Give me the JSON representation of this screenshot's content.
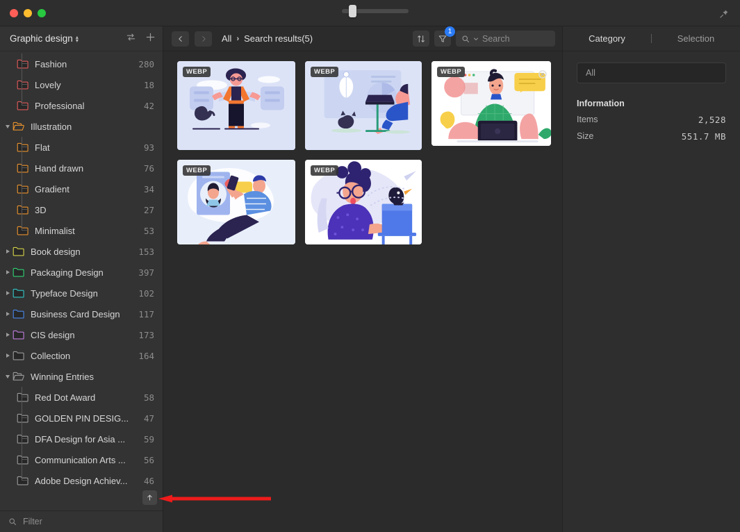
{
  "window": {
    "traffic_lights": [
      "close",
      "minimize",
      "maximize"
    ],
    "zoom_slider_value": 12,
    "pin_icon": "pin-icon"
  },
  "sidebar": {
    "library_title": "Graphic design",
    "header_icons": [
      "sort-transfer-icon",
      "plus-icon"
    ],
    "scroll_top_label": "↑",
    "filter_placeholder": "Filter",
    "items": [
      {
        "label": "Fashion",
        "count": "280",
        "level": 1,
        "color": "#e05a5a",
        "expandable": false,
        "open": false
      },
      {
        "label": "Lovely",
        "count": "18",
        "level": 1,
        "color": "#e05a5a",
        "expandable": false,
        "open": false
      },
      {
        "label": "Professional",
        "count": "42",
        "level": 1,
        "color": "#e05a5a",
        "expandable": false,
        "open": false
      },
      {
        "label": "Illustration",
        "count": "",
        "level": 0,
        "color": "#e8922e",
        "expandable": true,
        "open": true
      },
      {
        "label": "Flat",
        "count": "93",
        "level": 1,
        "color": "#e8922e",
        "expandable": false,
        "open": false
      },
      {
        "label": "Hand drawn",
        "count": "76",
        "level": 1,
        "color": "#e8922e",
        "expandable": false,
        "open": false
      },
      {
        "label": "Gradient",
        "count": "34",
        "level": 1,
        "color": "#e8922e",
        "expandable": false,
        "open": false
      },
      {
        "label": "3D",
        "count": "27",
        "level": 1,
        "color": "#e8922e",
        "expandable": false,
        "open": false
      },
      {
        "label": "Minimalist",
        "count": "53",
        "level": 1,
        "color": "#e8922e",
        "expandable": false,
        "open": false
      },
      {
        "label": "Book design",
        "count": "153",
        "level": 0,
        "color": "#d6d24a",
        "expandable": true,
        "open": false
      },
      {
        "label": "Packaging Design",
        "count": "397",
        "level": 0,
        "color": "#2fcf72",
        "expandable": true,
        "open": false
      },
      {
        "label": "Typeface Design",
        "count": "102",
        "level": 0,
        "color": "#31c5c5",
        "expandable": true,
        "open": false
      },
      {
        "label": "Business Card Design",
        "count": "117",
        "level": 0,
        "color": "#4a86e8",
        "expandable": true,
        "open": false
      },
      {
        "label": "CIS design",
        "count": "173",
        "level": 0,
        "color": "#c07ede",
        "expandable": true,
        "open": false
      },
      {
        "label": "Collection",
        "count": "164",
        "level": 0,
        "color": "#9a9a9a",
        "expandable": true,
        "open": false
      },
      {
        "label": "Winning Entries",
        "count": "",
        "level": 0,
        "color": "#9a9a9a",
        "expandable": true,
        "open": true
      },
      {
        "label": "Red Dot Award",
        "count": "58",
        "level": 1,
        "color": "#9a9a9a",
        "expandable": false,
        "open": false
      },
      {
        "label": "GOLDEN PIN DESIG...",
        "count": "47",
        "level": 1,
        "color": "#9a9a9a",
        "expandable": false,
        "open": false
      },
      {
        "label": "DFA Design for Asia ...",
        "count": "59",
        "level": 1,
        "color": "#9a9a9a",
        "expandable": false,
        "open": false
      },
      {
        "label": "Communication Arts ...",
        "count": "56",
        "level": 1,
        "color": "#9a9a9a",
        "expandable": false,
        "open": false
      },
      {
        "label": "Adobe Design Achiev...",
        "count": "46",
        "level": 1,
        "color": "#9a9a9a",
        "expandable": false,
        "open": false
      }
    ]
  },
  "toolbar": {
    "back_icon": "chevron-left-icon",
    "forward_icon": "chevron-right-icon",
    "breadcrumb_root": "All",
    "breadcrumb_separator": "›",
    "breadcrumb_current": "Search results(5)",
    "sort_icon": "sort-arrows-icon",
    "filter_icon": "filter-funnel-icon",
    "filter_badge": "1",
    "filter_badge_color": "#2a7bf6",
    "search_placeholder": "Search",
    "search_value": ""
  },
  "grid": {
    "format_label": "WEBP",
    "items": [
      {
        "name": "illustration-man-standing-cat",
        "format": "WEBP",
        "width": 170,
        "height": 128,
        "bg": "#dde3f7"
      },
      {
        "name": "illustration-woman-laptop-desk",
        "format": "WEBP",
        "width": 168,
        "height": 128,
        "bg": "#dde3f7"
      },
      {
        "name": "illustration-person-green-shirt-laptop",
        "format": "WEBP",
        "width": 172,
        "height": 122,
        "bg": "#ffffff"
      },
      {
        "name": "illustration-person-phone-reclining",
        "format": "WEBP",
        "width": 170,
        "height": 122,
        "bg": "#e8effa"
      },
      {
        "name": "illustration-woman-glasses-toucan",
        "format": "WEBP",
        "width": 168,
        "height": 122,
        "bg": "#ffffff"
      }
    ]
  },
  "right_panel": {
    "tabs": [
      {
        "label": "Category",
        "active": true
      },
      {
        "label": "Selection",
        "active": false
      }
    ],
    "scope_value": "All",
    "information_heading": "Information",
    "rows": [
      {
        "key": "Items",
        "value": "2,528"
      },
      {
        "key": "Size",
        "value": "551.7 MB"
      }
    ]
  },
  "annotation": {
    "arrow_color": "#ee1b1b",
    "points_to": "scroll-to-top-button"
  }
}
